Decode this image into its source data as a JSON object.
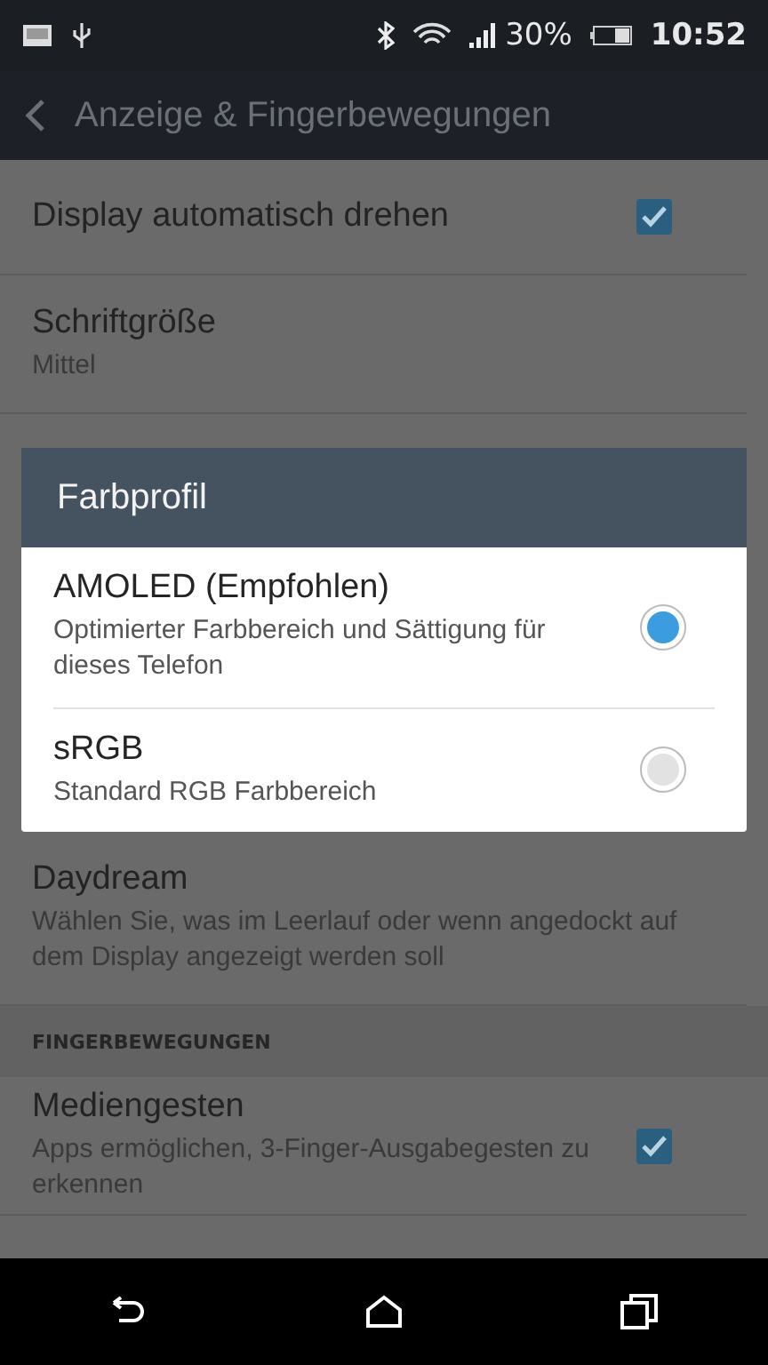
{
  "status_bar": {
    "battery": "30%",
    "time": "10:52"
  },
  "app_bar": {
    "title": "Anzeige & Fingerbewegungen"
  },
  "settings": [
    {
      "kind": "checkbox",
      "title": "Display automatisch drehen",
      "checked": true
    },
    {
      "kind": "value",
      "title": "Schriftgröße",
      "subtitle": "Mittel"
    },
    {
      "kind": "gap"
    },
    {
      "kind": "text",
      "title": "Daydream",
      "subtitle": "Wählen Sie, was im Leerlauf oder wenn angedockt auf dem Display angezeigt werden soll"
    },
    {
      "kind": "header",
      "title": "FINGERBEWEGUNGEN"
    },
    {
      "kind": "checkbox",
      "title": "Mediengesten",
      "subtitle": "Apps ermöglichen, 3-Finger-Ausgabegesten zu erkennen",
      "checked": true
    }
  ],
  "dialog": {
    "title": "Farbprofil",
    "options": [
      {
        "label": "AMOLED (Empfohlen)",
        "description": "Optimierter Farbbereich und Sättigung für dieses Telefon",
        "selected": true
      },
      {
        "label": "sRGB",
        "description": "Standard RGB Farbbereich",
        "selected": false
      }
    ]
  }
}
